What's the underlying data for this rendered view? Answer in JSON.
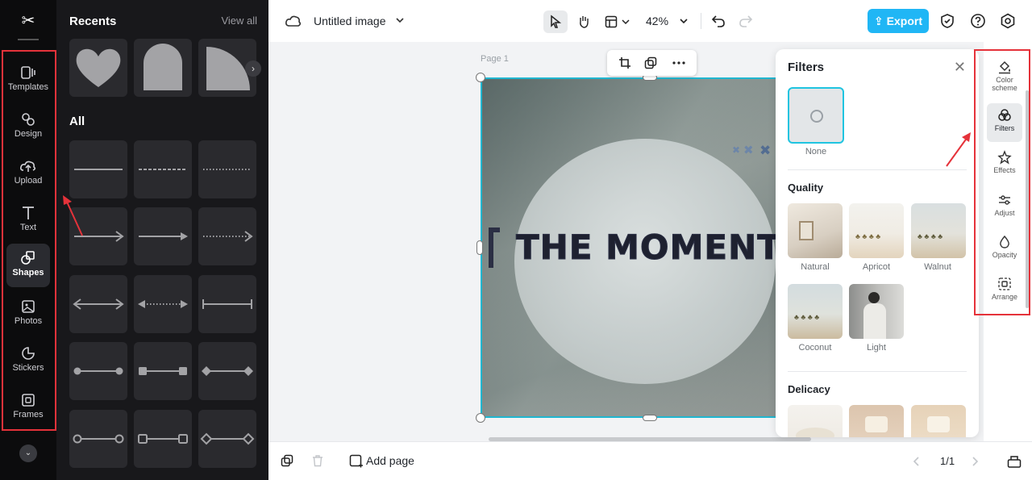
{
  "rail": {
    "logo": "✂",
    "items": [
      {
        "label": "Templates",
        "icon": "templates-icon"
      },
      {
        "label": "Design",
        "icon": "design-icon"
      },
      {
        "label": "Upload",
        "icon": "upload-icon"
      },
      {
        "label": "Text",
        "icon": "text-icon"
      },
      {
        "label": "Shapes",
        "icon": "shapes-icon",
        "active": true
      },
      {
        "label": "Photos",
        "icon": "photos-icon"
      },
      {
        "label": "Stickers",
        "icon": "stickers-icon"
      },
      {
        "label": "Frames",
        "icon": "frames-icon"
      }
    ]
  },
  "panel": {
    "recents_label": "Recents",
    "view_all_label": "View all",
    "all_label": "All"
  },
  "topbar": {
    "doc_title": "Untitled image",
    "zoom": "42%",
    "export_label": "Export"
  },
  "canvas": {
    "page_label": "Page 1",
    "headline": "THE MOMENT."
  },
  "filters": {
    "title": "Filters",
    "none_label": "None",
    "quality_label": "Quality",
    "quality_items": [
      "Natural",
      "Apricot",
      "Walnut",
      "Coconut",
      "Light"
    ],
    "delicacy_label": "Delicacy"
  },
  "right_rail": {
    "items": [
      {
        "label": "Color scheme",
        "icon": "color-scheme-icon"
      },
      {
        "label": "Filters",
        "icon": "filters-icon",
        "active": true
      },
      {
        "label": "Effects",
        "icon": "effects-icon"
      },
      {
        "label": "Adjust",
        "icon": "adjust-icon"
      },
      {
        "label": "Opacity",
        "icon": "opacity-icon"
      },
      {
        "label": "Arrange",
        "icon": "arrange-icon"
      }
    ]
  },
  "bottombar": {
    "add_page_label": "Add page",
    "page_indicator": "1/1"
  },
  "colors": {
    "accent": "#20b6f5",
    "selection": "#20b6d0",
    "annotation": "#e5323a"
  }
}
